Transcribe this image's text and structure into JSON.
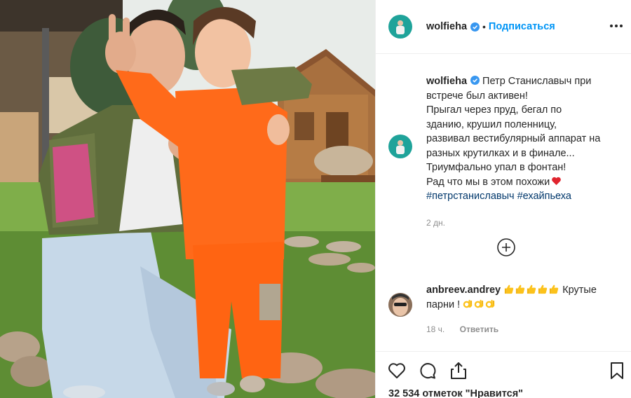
{
  "post": {
    "photo_alt": "",
    "author": {
      "username": "wolfieha",
      "verified_icon": "verified-badge-icon",
      "separator": "•",
      "follow_label": "Подписаться"
    },
    "more_icon": "more-options-icon",
    "caption": {
      "username": "wolfieha",
      "lines": [
        "Петр Станиславыч при",
        "встрече был активен!",
        "Прыгал через пруд, бегал по",
        "зданию, крушил поленницу,",
        "развивал вестибулярный аппарат на",
        "разных крутилках и в финале...",
        "Триумфально упал в фонтан!",
        "Рад что мы в этом похожи"
      ],
      "heart_emoji": "❤️",
      "hashtags": [
        "#петрстаниславыч",
        "#ехайпьеха"
      ],
      "time": "2 дн."
    },
    "load_more_icon": "plus-circle-icon",
    "comments": [
      {
        "username": "anbreev.andrey",
        "text_line1_after_emojis": "Крутые",
        "text_line2": "парни !",
        "thumbs_count": 5,
        "ok_count": 3,
        "time": "18 ч.",
        "reply_label": "Ответить"
      }
    ],
    "actions": {
      "like_icon": "heart-icon",
      "comment_icon": "comment-icon",
      "share_icon": "share-icon",
      "save_icon": "bookmark-icon"
    },
    "likes_text": "32 534 отметок \"Нравится\""
  },
  "colors": {
    "link_blue": "#0095f6",
    "hashtag": "#00376b",
    "meta_gray": "#8e8e8e",
    "divider": "#efefef",
    "avatar_teal": "#1fa39a"
  }
}
